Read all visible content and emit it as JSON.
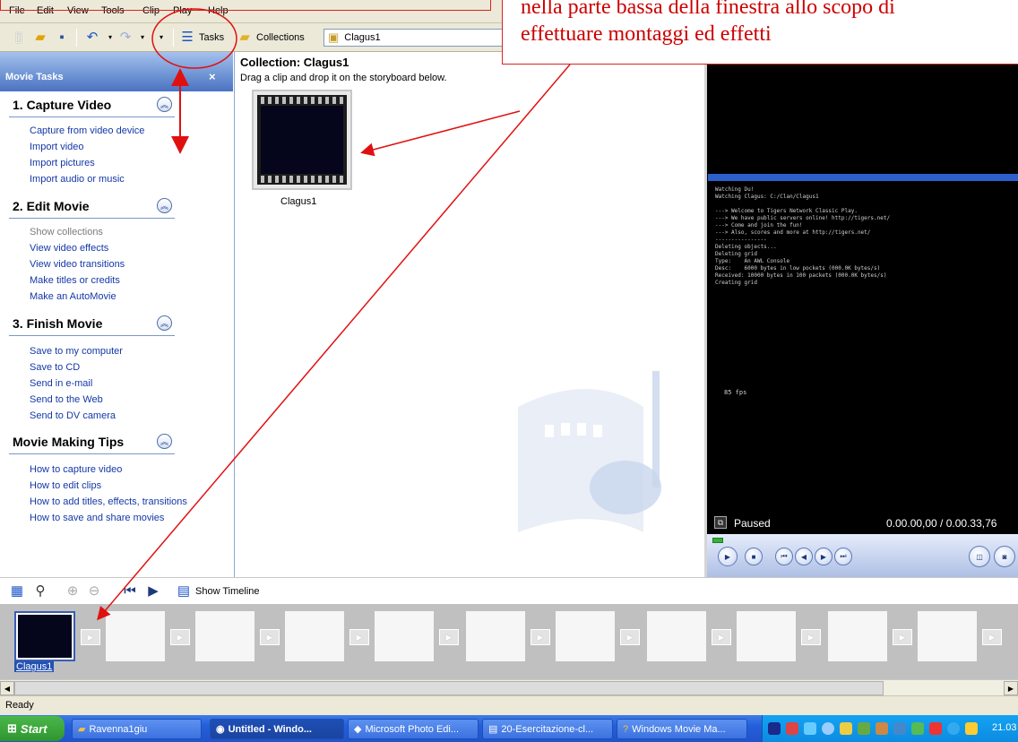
{
  "menu": [
    "File",
    "Edit",
    "View",
    "Tools",
    "Clip",
    "Play",
    "Help"
  ],
  "toolbar": {
    "tasks_label": "Tasks",
    "collections_label": "Collections",
    "collection_value": "Clagus1"
  },
  "taskpane": {
    "title": "Movie Tasks",
    "close": "×",
    "sections": [
      {
        "title": "1. Capture Video",
        "items": [
          "Capture from video device",
          "Import video",
          "Import pictures",
          "Import audio or music"
        ]
      },
      {
        "title": "2. Edit Movie",
        "items": [
          "Show collections",
          "View video effects",
          "View video transitions",
          "Make titles or credits",
          "Make an AutoMovie"
        ]
      },
      {
        "title": "3. Finish Movie",
        "items": [
          "Save to my computer",
          "Save to CD",
          "Send in e-mail",
          "Send to the Web",
          "Send to DV camera"
        ]
      },
      {
        "title": "Movie Making Tips",
        "items": [
          "How to capture video",
          "How to edit clips",
          "How to add titles, effects, transitions",
          "How to save and share movies"
        ]
      }
    ]
  },
  "collection": {
    "title": "Collection: Clagus1",
    "subtitle": "Drag a clip and drop it on the storyboard below.",
    "clip_label": "Clagus1"
  },
  "monitor": {
    "console_lines": "Watching Du!\nWatching Clagus: C:/Clan/Clagus1\n\n---> Welcome to Tigers Network Classic Play.\n---> We have public servers online! http://tigers.net/\n---> Come and join the fun!\n---> Also, scores and more at http://tigers.net/\n----------------\nDeleting objects...\nDeleting grid\nType:    An AWL Console\nDesc:    6000 bytes in low pockets (000.0K bytes/s)\nReceived: 10000 bytes in 100 packets (000.0K bytes/s)\nCreating grid",
    "console_fps": "85 fps",
    "status": "Paused",
    "time": "0.00.00,00 / 0.00.33,76"
  },
  "storyboard": {
    "show_timeline": "Show Timeline",
    "first_clip_label": "Clagus1"
  },
  "status_bar": "Ready",
  "taskbar": {
    "start": "Start",
    "buttons": [
      "Ravenna1giu",
      "Untitled - Windo...",
      "Microsoft Photo Edi...",
      "20-Esercitazione-cl...",
      "Windows Movie Ma..."
    ],
    "clock": "21.03"
  },
  "annotation": {
    "text": "nella parte bassa della finestra allo scopo di\neffettuare montaggi ed effetti"
  },
  "colors": {
    "annotation_red": "#cc0000",
    "taskpane_blue": "#4b72c3",
    "link_blue": "#1438a6"
  }
}
